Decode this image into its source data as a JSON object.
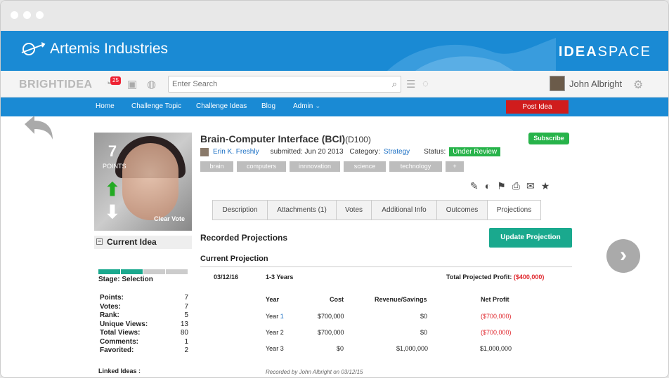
{
  "banner": {
    "company": "Artemis Industries",
    "product_a": "IDEA",
    "product_b": "SPACE"
  },
  "toolbar": {
    "logo": "BRIGHTIDEA",
    "notif_count": "25",
    "search_placeholder": "Enter Search",
    "user_name": "John Albright"
  },
  "nav": {
    "items": [
      "Home",
      "Challenge Topic",
      "Challenge Ideas",
      "Blog",
      "Admin"
    ],
    "post_idea": "Post Idea"
  },
  "idea": {
    "title": "Brain-Computer Interface (BCI)",
    "id": "(D100)",
    "author": "Erin K. Freshly",
    "submitted": "submitted: Jun 20 2013",
    "category_label": "Category:",
    "category": "Strategy",
    "status_label": "Status:",
    "status": "Under Review",
    "tags": [
      "brain",
      "computers",
      "innnovation",
      "science",
      "technology",
      "+"
    ],
    "subscribe": "Subscribe"
  },
  "vote": {
    "points": "7",
    "points_label": "POINTS",
    "clear": "Clear Vote"
  },
  "sidebar": {
    "current_idea": "Current Idea",
    "stage": "Stage: Selection",
    "stage_progress": 0.5,
    "stats": [
      {
        "k": "Points:",
        "v": "7"
      },
      {
        "k": "Votes:",
        "v": "7"
      },
      {
        "k": "Rank:",
        "v": "5"
      },
      {
        "k": "Unique Views:",
        "v": "13"
      },
      {
        "k": "Total Views:",
        "v": "80"
      },
      {
        "k": "Comments:",
        "v": "1"
      },
      {
        "k": "Favorited:",
        "v": "2"
      }
    ],
    "linked": "Linked Ideas :"
  },
  "tabs": [
    "Description",
    "Attachments (1)",
    "Votes",
    "Additional Info",
    "Outcomes",
    "Projections"
  ],
  "projections": {
    "heading": "Recorded Projections",
    "update_button": "Update Projection",
    "current": "Current Projection",
    "date": "03/12/16",
    "range": "1-3 Years",
    "total_label": "Total Projected Profit:",
    "total_value": "($400,000)",
    "headers": [
      "Year",
      "Cost",
      "Revenue/Savings",
      "Net Profit"
    ],
    "rows": [
      {
        "year": "Year ",
        "year_num": "1",
        "cost": "$700,000",
        "revenue": "$0",
        "net": "($700,000)",
        "neg": true
      },
      {
        "year": "Year ",
        "year_num": "2",
        "cost": "$700,000",
        "revenue": "$0",
        "net": "($700,000)",
        "neg": true
      },
      {
        "year": "Year ",
        "year_num": "3",
        "cost": "$0",
        "revenue": "$1,000,000",
        "net": "$1,000,000",
        "neg": false
      }
    ],
    "recorded": "Recorded by John Albright on 03/12/15"
  },
  "colors": {
    "brand": "#1a8ad4",
    "teal": "#1aa98e",
    "green": "#27b34a",
    "red": "#d01c1c"
  }
}
